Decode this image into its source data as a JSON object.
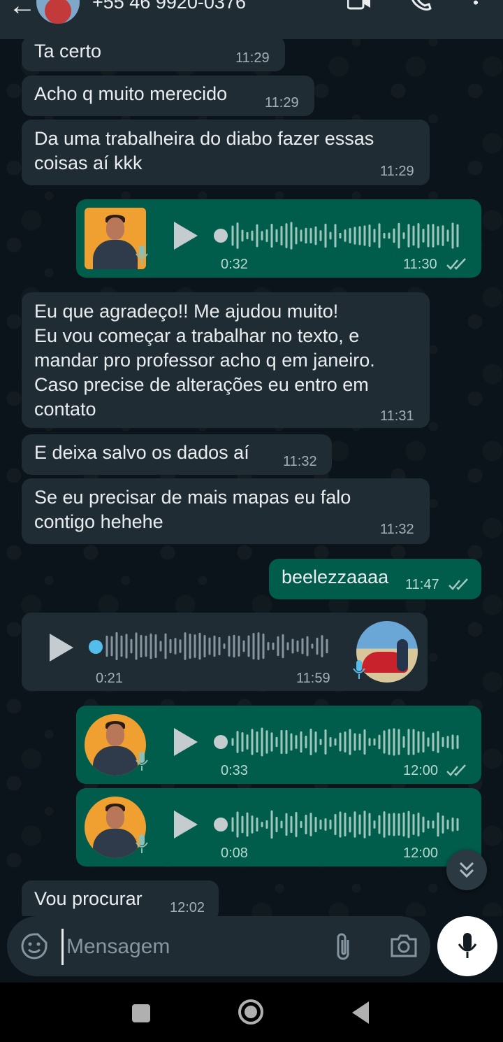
{
  "header": {
    "contact": "+55 46 9920-0376",
    "back_icon": "back-arrow-icon",
    "video_icon": "video-call-icon",
    "call_icon": "phone-icon",
    "menu_icon": "more-vertical-icon"
  },
  "messages": [
    {
      "dir": "in",
      "text": "Ta certo",
      "time": "11:29"
    },
    {
      "dir": "in",
      "text": "Acho q muito merecido",
      "time": "11:29"
    },
    {
      "dir": "in",
      "text": "Da uma trabalheira do diabo fazer essas\ncoisas aí kkk",
      "time": "11:29"
    },
    {
      "dir": "out",
      "type": "voice",
      "duration": "0:32",
      "time": "11:30",
      "status": "read"
    },
    {
      "dir": "in",
      "text": "Eu que agradeço!! Me ajudou muito!\nEu vou começar a trabalhar no texto, e\nmandar pro professor acho q em janeiro.\nCaso precise de alterações eu entro em\ncontato",
      "time": "11:31"
    },
    {
      "dir": "in",
      "text": "E deixa salvo os dados aí",
      "time": "11:32"
    },
    {
      "dir": "in",
      "text": "Se eu precisar de mais mapas eu falo\ncontigo hehehe",
      "time": "11:32"
    },
    {
      "dir": "out",
      "text": "beelezzaaaa",
      "time": "11:47",
      "status": "read"
    },
    {
      "dir": "in",
      "type": "voice",
      "duration": "0:21",
      "time": "11:59"
    },
    {
      "dir": "out",
      "type": "voice",
      "duration": "0:33",
      "time": "12:00",
      "status": "read"
    },
    {
      "dir": "out",
      "type": "voice",
      "duration": "0:08",
      "time": "12:00",
      "status": "read"
    },
    {
      "dir": "in",
      "text": "Vou procurar",
      "time": "12:02"
    }
  ],
  "composer": {
    "placeholder": "Mensagem",
    "emoji_icon": "sticker-icon",
    "attach_icon": "paperclip-icon",
    "camera_icon": "camera-icon",
    "mic_icon": "microphone-icon"
  },
  "colors": {
    "background": "#0b141a",
    "incoming_bubble": "#202c33",
    "outgoing_bubble": "#005c4b",
    "unplayed_dot": "#53bdeb",
    "read_ticks": "#a3c9bf"
  }
}
